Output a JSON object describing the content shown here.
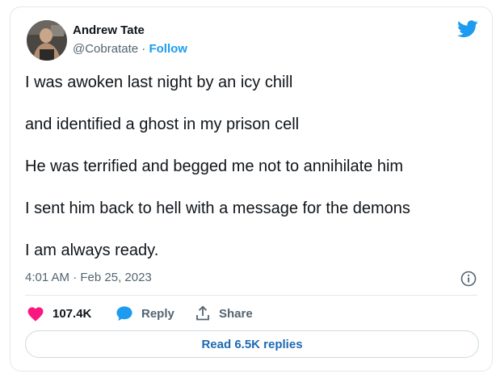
{
  "author": {
    "name": "Andrew Tate",
    "handle": "@Cobratate",
    "separator": "·",
    "follow_label": "Follow"
  },
  "tweet": {
    "lines": [
      "I was awoken last night by an icy chill",
      "and identified a ghost in my prison cell",
      "He was terrified and begged me not to annihilate him",
      "I sent him back to hell with a message for the demons",
      "I am always ready."
    ],
    "timestamp": "4:01 AM · Feb 25, 2023"
  },
  "actions": {
    "likes": "107.4K",
    "reply_label": "Reply",
    "share_label": "Share"
  },
  "read_replies_label": "Read 6.5K replies",
  "colors": {
    "brand_blue": "#1d9bf0",
    "like_pink": "#f91880",
    "text_primary": "#0f1419",
    "text_secondary": "#536471",
    "border": "#e1e8ed"
  },
  "icons": [
    "twitter-bird-icon",
    "info-icon",
    "heart-icon",
    "reply-bubble-icon",
    "share-upload-icon"
  ]
}
